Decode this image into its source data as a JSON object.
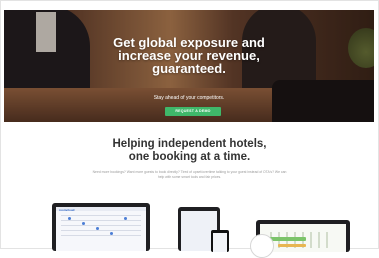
{
  "hero": {
    "headline": "Get global exposure and\nincrease your revenue,\nguaranteed.",
    "tagline": "Stay ahead of your competitors.",
    "cta_label": "REQUEST A DEMO"
  },
  "section": {
    "title": "Helping independent hotels,\none booking at a time.",
    "blurb": "Need more bookings? Want more guests to book directly? Tired of upset/overtime talking to your guest instead of OTA's? We can help with some smart tools and fair prices."
  },
  "devices": {
    "laptop_logo": "roomcloud"
  },
  "colors": {
    "cta": "#3fb86a",
    "heading": "#333333"
  }
}
